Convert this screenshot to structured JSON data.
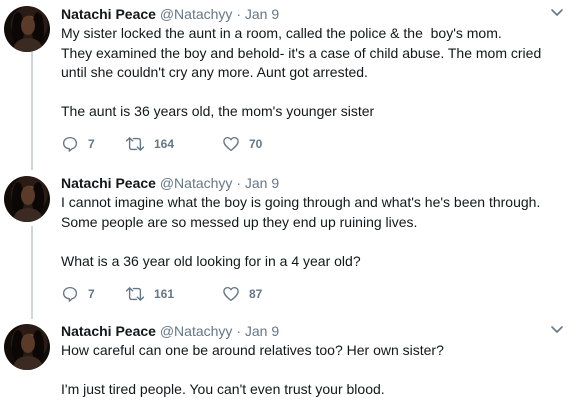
{
  "tweets": [
    {
      "name": "Natachi Peace",
      "handle": "@Natachyy",
      "separator": "·",
      "date": "Jan 9",
      "text": "My sister locked the aunt in a room, called the police & the  boy's mom.\nThey examined the boy and behold- it's a case of child abuse. The mom cried\nuntil she couldn't cry any more. Aunt got arrested.\n\nThe aunt is 36 years old, the mom's younger sister",
      "replies": "7",
      "retweets": "164",
      "likes": "70"
    },
    {
      "name": "Natachi Peace",
      "handle": "@Natachyy",
      "separator": "·",
      "date": "Jan 9",
      "text": "I cannot imagine what the boy is going through and what's he's been through.\nSome people are so messed up they end up ruining lives.\n\nWhat is a 36 year old looking for in a 4 year old?",
      "replies": "7",
      "retweets": "161",
      "likes": "87"
    },
    {
      "name": "Natachi Peace",
      "handle": "@Natachyy",
      "separator": "·",
      "date": "Jan 9",
      "text": "How careful can one be around relatives too? Her own sister?\n\nI'm just tired people. You can't even trust your blood."
    }
  ],
  "colors": {
    "text": "#14171a",
    "muted": "#657786",
    "thread_line": "#ccd6dd"
  },
  "icons": {
    "reply": "reply-icon",
    "retweet": "retweet-icon",
    "like": "heart-icon",
    "more": "chevron-down-icon"
  }
}
